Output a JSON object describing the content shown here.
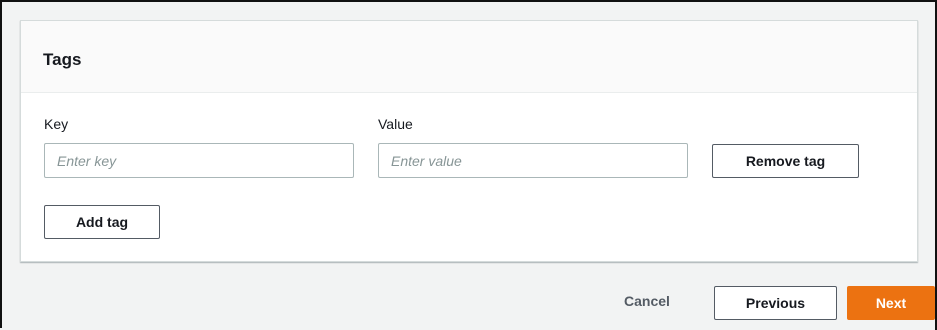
{
  "tags_panel": {
    "title": "Tags",
    "key_label": "Key",
    "value_label": "Value",
    "key_placeholder": "Enter key",
    "value_placeholder": "Enter value",
    "key_value": "",
    "value_value": "",
    "remove_tag_label": "Remove tag",
    "add_tag_label": "Add tag"
  },
  "footer": {
    "cancel_label": "Cancel",
    "previous_label": "Previous",
    "next_label": "Next"
  },
  "colors": {
    "primary": "#ec7211",
    "background": "#f2f3f3",
    "border": "#aab7b8"
  }
}
